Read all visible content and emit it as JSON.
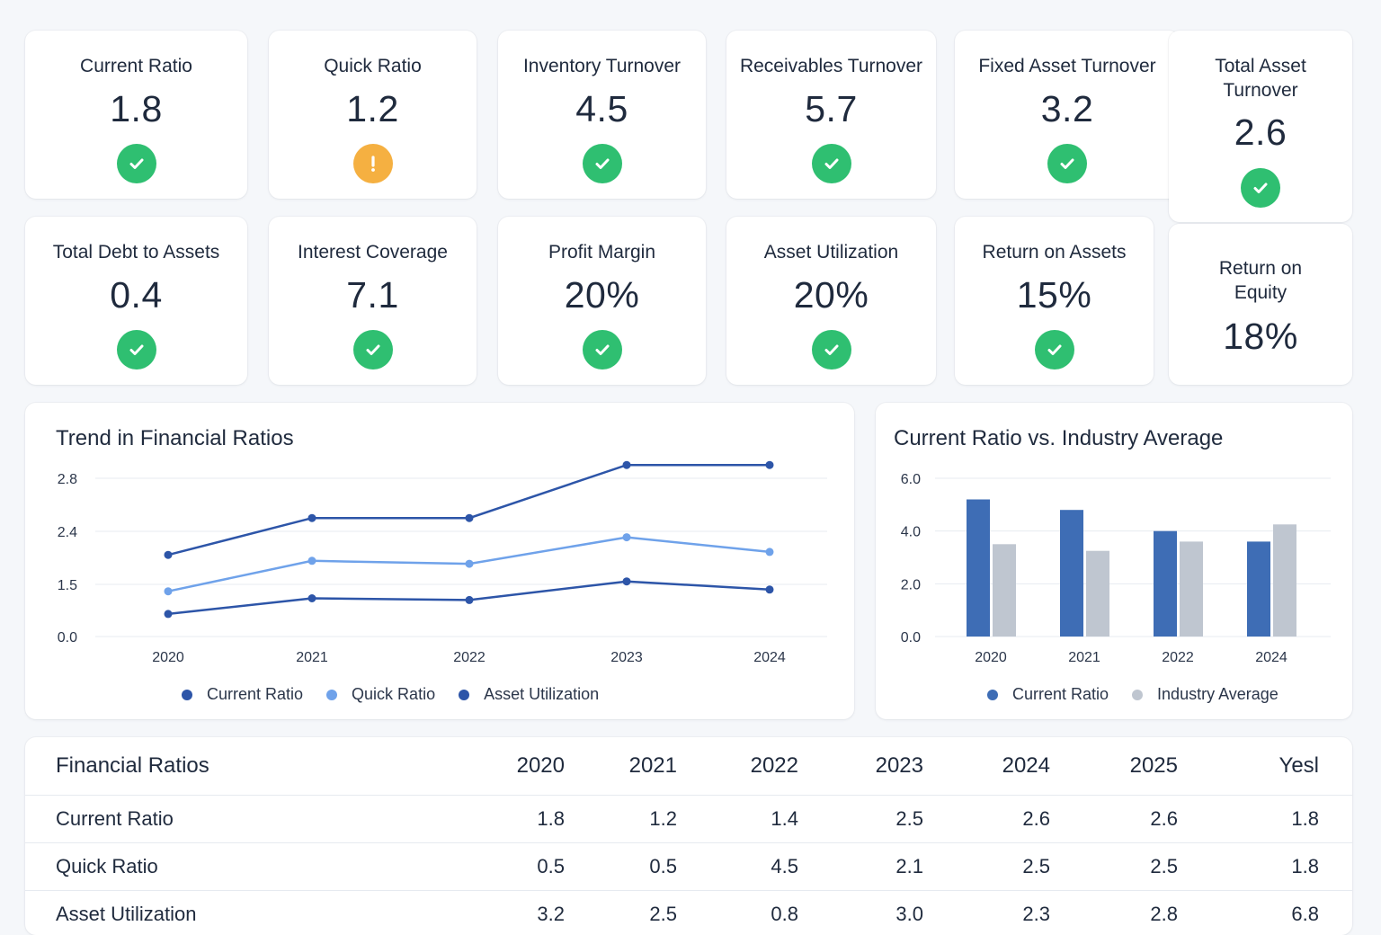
{
  "kpis": [
    {
      "label": "Current Ratio",
      "value": "1.8",
      "status": "ok",
      "icon": "check-icon"
    },
    {
      "label": "Quick Ratio",
      "value": "1.2",
      "status": "warn",
      "icon": "warning-icon"
    },
    {
      "label": "Inventory Turnover",
      "value": "4.5",
      "status": "ok",
      "icon": "check-icon"
    },
    {
      "label": "Receivables Turnover",
      "value": "5.7",
      "status": "ok",
      "icon": "check-icon"
    },
    {
      "label": "Fixed Asset Turnover",
      "value": "3.2",
      "status": "ok",
      "icon": "check-icon"
    },
    {
      "label": "Total Asset Turnover",
      "value": "2.6",
      "status": "ok",
      "icon": "check-icon"
    },
    {
      "label": "Total Debt to Assets",
      "value": "0.4",
      "status": "ok",
      "icon": "check-icon"
    },
    {
      "label": "Interest Coverage",
      "value": "7.1",
      "status": "ok",
      "icon": "check-icon"
    },
    {
      "label": "Profit Margin",
      "value": "20%",
      "status": "ok",
      "icon": "check-icon"
    },
    {
      "label": "Asset Utilization",
      "value": "20%",
      "status": "ok",
      "icon": "check-icon"
    },
    {
      "label": "Return on Assets",
      "value": "15%",
      "status": "ok",
      "icon": "check-icon"
    },
    {
      "label": "Return on Equity",
      "value": "18%"
    }
  ],
  "colors": {
    "ok": "#2fbf71",
    "warn": "#f5b041",
    "dark_blue": "#2d55a8",
    "light_blue": "#6fa2ea",
    "bar_blue": "#3e6db5",
    "bar_gray": "#bfc6d0"
  },
  "chart_data": [
    {
      "type": "line",
      "title": "Trend in Financial Ratios",
      "x": [
        "2020",
        "2021",
        "2022",
        "2023",
        "2024"
      ],
      "yticks": [
        "0.0",
        "1.5",
        "2.4",
        "2.8"
      ],
      "ylim": [
        0,
        3
      ],
      "series": [
        {
          "name": "Current Ratio",
          "values": [
            2.0,
            2.5,
            2.5,
            2.9,
            2.9
          ],
          "color": "#2d55a8"
        },
        {
          "name": "Quick Ratio",
          "values": [
            1.3,
            1.9,
            1.85,
            2.3,
            2.05
          ],
          "color": "#6fa2ea"
        },
        {
          "name": "Asset Utilization",
          "values": [
            0.65,
            1.1,
            1.05,
            1.55,
            1.35
          ],
          "color": "#2d55a8"
        }
      ],
      "grid": true,
      "legend": "bottom"
    },
    {
      "type": "bar",
      "title": "Current Ratio vs. Industry Average",
      "categories": [
        "2020",
        "2021",
        "2022",
        "2024"
      ],
      "yticks": [
        "0.0",
        "2.0",
        "4.0",
        "6.0"
      ],
      "ylim": [
        0,
        6
      ],
      "series": [
        {
          "name": "Current Ratio",
          "values": [
            5.2,
            4.8,
            4.0,
            3.6
          ],
          "color": "#3e6db5"
        },
        {
          "name": "Industry Average",
          "values": [
            3.5,
            3.25,
            3.6,
            4.25
          ],
          "color": "#bfc6d0"
        }
      ],
      "grid": true,
      "legend": "bottom"
    }
  ],
  "table": {
    "title": "Financial Ratios",
    "columns": [
      "2020",
      "2021",
      "2022",
      "2023",
      "2024",
      "2025",
      "Yesl"
    ],
    "rows": [
      {
        "name": "Current Ratio",
        "values": [
          "1.8",
          "1.2",
          "1.4",
          "2.5",
          "2.6",
          "2.6",
          "1.8"
        ]
      },
      {
        "name": "Quick Ratio",
        "values": [
          "0.5",
          "0.5",
          "4.5",
          "2.1",
          "2.5",
          "2.5",
          "1.8"
        ]
      },
      {
        "name": "Asset Utilization",
        "values": [
          "3.2",
          "2.5",
          "0.8",
          "3.0",
          "2.3",
          "2.8",
          "6.8"
        ]
      }
    ]
  }
}
